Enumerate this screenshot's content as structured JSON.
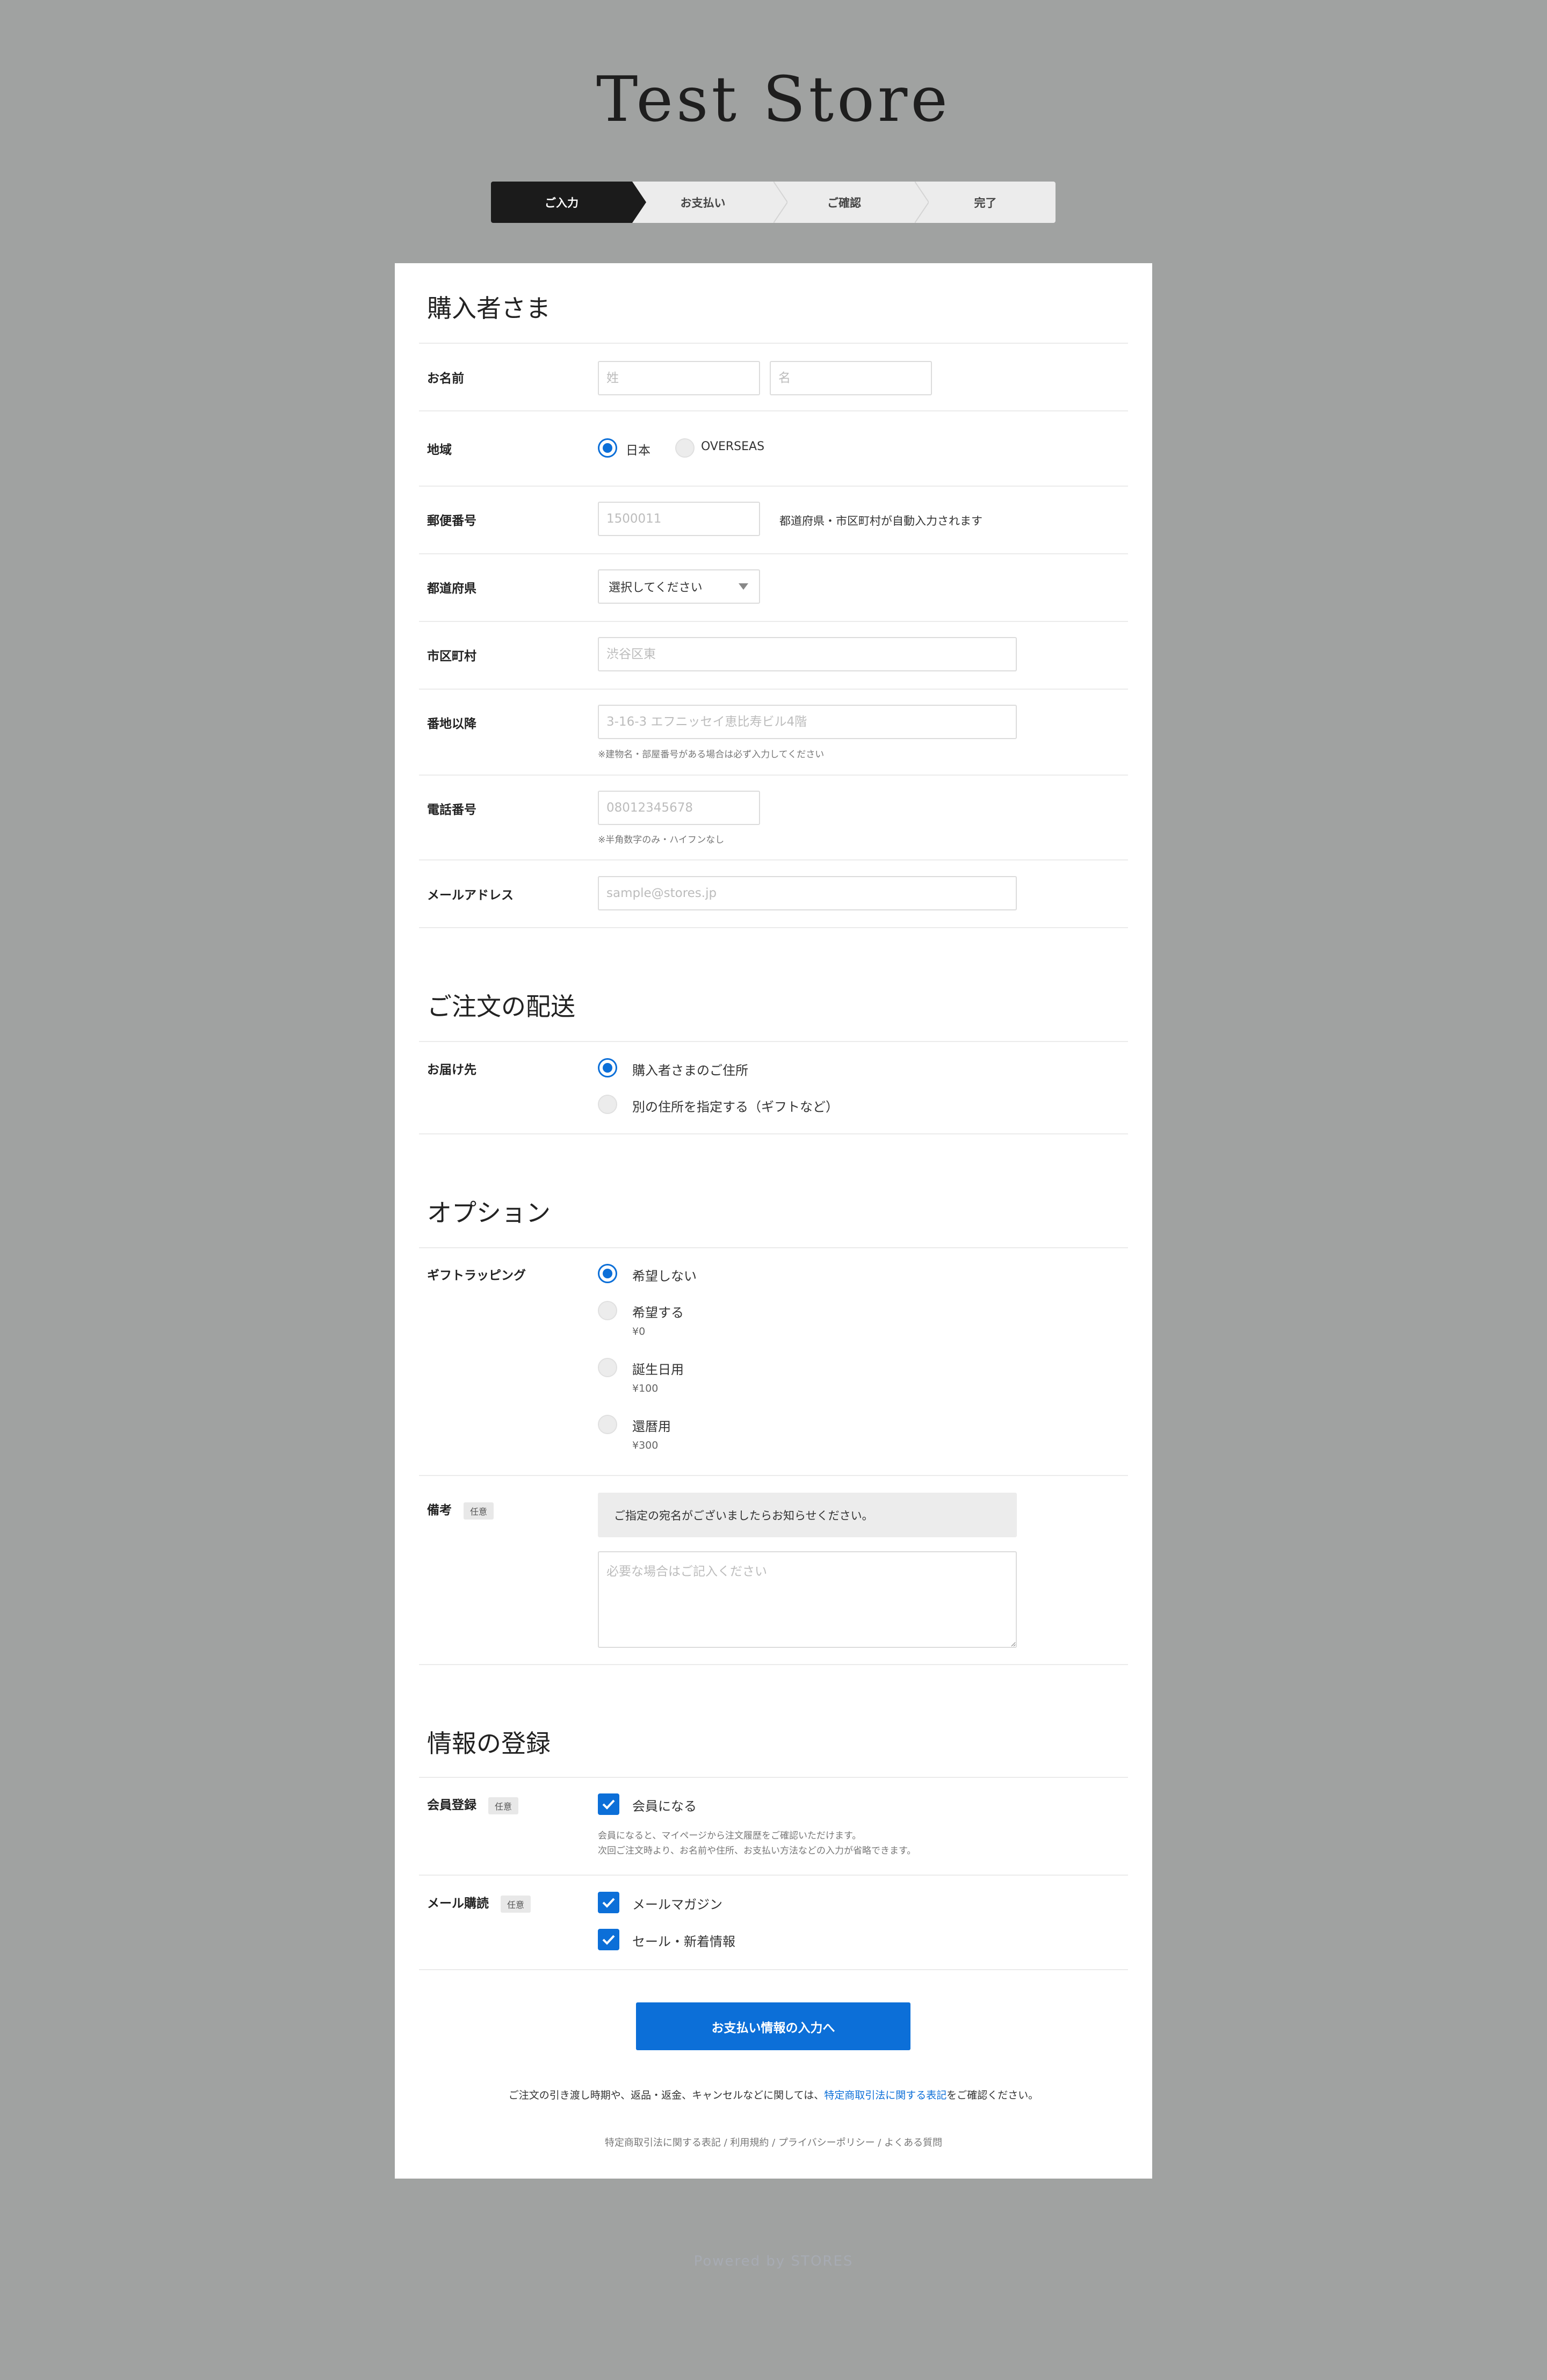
{
  "store": {
    "title": "Test Store"
  },
  "steps": [
    "ご入力",
    "お支払い",
    "ご確認",
    "完了"
  ],
  "buyer": {
    "title": "購入者さま",
    "name_label": "お名前",
    "last_name_placeholder": "姓",
    "first_name_placeholder": "名",
    "region_label": "地域",
    "region_japan": "日本",
    "region_overseas": "OVERSEAS",
    "postal_label": "郵便番号",
    "postal_placeholder": "1500011",
    "postal_hint": "都道府県・市区町村が自動入力されます",
    "prefecture_label": "都道府県",
    "prefecture_value": "選択してください",
    "city_label": "市区町村",
    "city_placeholder": "渋谷区東",
    "address_label": "番地以降",
    "address_placeholder": "3-16-3 エフニッセイ恵比寿ビル4階",
    "address_note": "※建物名・部屋番号がある場合は必ず入力してください",
    "phone_label": "電話番号",
    "phone_placeholder": "08012345678",
    "phone_note": "※半角数字のみ・ハイフンなし",
    "email_label": "メールアドレス",
    "email_placeholder": "sample@stores.jp"
  },
  "delivery": {
    "title": "ご注文の配送",
    "destination_label": "お届け先",
    "option_buyer": "購入者さまのご住所",
    "option_other": "別の住所を指定する（ギフトなど）"
  },
  "options": {
    "title": "オプション",
    "gift_label": "ギフトラッピング",
    "gift_items": [
      {
        "label": "希望しない",
        "price": ""
      },
      {
        "label": "希望する",
        "price": "¥0"
      },
      {
        "label": "誕生日用",
        "price": "¥100"
      },
      {
        "label": "還暦用",
        "price": "¥300"
      }
    ],
    "notes_label": "備考",
    "optional_badge": "任意",
    "notes_info": "ご指定の宛名がございましたらお知らせください。",
    "notes_placeholder": "必要な場合はご記入ください"
  },
  "registration": {
    "title": "情報の登録",
    "member_label": "会員登録",
    "member_option": "会員になる",
    "member_note_1": "会員になると、マイページから注文履歴をご確認いただけます。",
    "member_note_2": "次回ご注文時より、お名前や住所、お支払い方法などの入力が省略できます。",
    "mail_label": "メール購読",
    "mail_magazine": "メールマガジン",
    "mail_sale": "セール・新着情報"
  },
  "submit_label": "お支払い情報の入力へ",
  "legal": {
    "prefix": "ご注文の引き渡し時期や、返品・返金、キャンセルなどに関しては、",
    "link": "特定商取引法に関する表記",
    "suffix": "をご確認ください。"
  },
  "footer_links": [
    "特定商取引法に関する表記",
    "利用規約",
    "プライバシーポリシー",
    "よくある質問"
  ],
  "powered_by": "Powered by STORES"
}
